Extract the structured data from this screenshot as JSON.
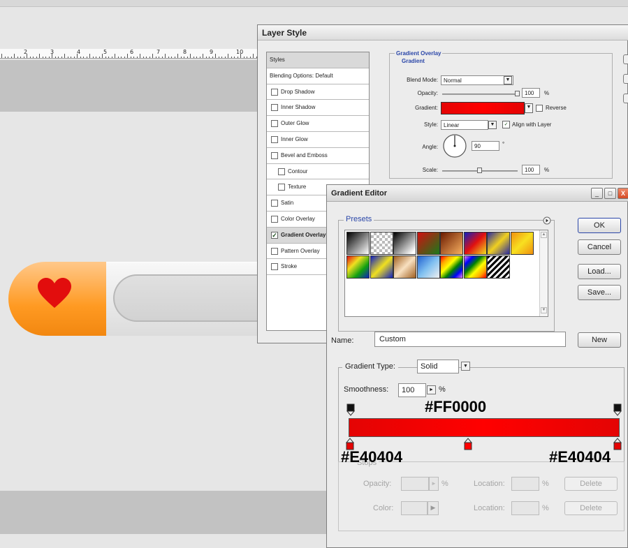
{
  "background": {
    "ruler_numbers": [
      "2",
      "3",
      "4",
      "5",
      "6",
      "7",
      "8",
      "9",
      "10"
    ]
  },
  "layer_style": {
    "title": "Layer Style",
    "styles_list": [
      {
        "label": "Styles",
        "type": "head"
      },
      {
        "label": "Blending Options: Default",
        "type": "head"
      },
      {
        "label": "Drop Shadow",
        "checked": false
      },
      {
        "label": "Inner Shadow",
        "checked": false
      },
      {
        "label": "Outer Glow",
        "checked": false
      },
      {
        "label": "Inner Glow",
        "checked": false
      },
      {
        "label": "Bevel and Emboss",
        "checked": false
      },
      {
        "label": "Contour",
        "checked": false,
        "sub": true
      },
      {
        "label": "Texture",
        "checked": false,
        "sub": true
      },
      {
        "label": "Satin",
        "checked": false
      },
      {
        "label": "Color Overlay",
        "checked": false
      },
      {
        "label": "Gradient Overlay",
        "checked": true,
        "selected": true
      },
      {
        "label": "Pattern Overlay",
        "checked": false
      },
      {
        "label": "Stroke",
        "checked": false
      }
    ],
    "panel": {
      "section_title": "Gradient Overlay",
      "group_title": "Gradient",
      "blend_mode_label": "Blend Mode:",
      "blend_mode_value": "Normal",
      "opacity_label": "Opacity:",
      "opacity_value": "100",
      "opacity_unit": "%",
      "opacity_level": 1.0,
      "gradient_label": "Gradient:",
      "reverse_label": "Reverse",
      "reverse_checked": false,
      "style_label": "Style:",
      "style_value": "Linear",
      "align_label": "Align with Layer",
      "align_checked": true,
      "angle_label": "Angle:",
      "angle_value": "90",
      "angle_unit": "°",
      "scale_label": "Scale:",
      "scale_value": "100",
      "scale_unit": "%",
      "scale_level": 0.5
    }
  },
  "gradient_editor": {
    "title": "Gradient Editor",
    "window_controls": {
      "minimize": "_",
      "maximize": "□",
      "close": "X"
    },
    "presets_label": "Presets",
    "presets_menu_icon": "arrow-circle-icon",
    "buttons": {
      "ok": "OK",
      "cancel": "Cancel",
      "load": "Load...",
      "save": "Save...",
      "new": "New"
    },
    "name_label": "Name:",
    "name_value": "Custom",
    "gradient_type_label": "Gradient Type:",
    "gradient_type_value": "Solid",
    "smoothness_label": "Smoothness:",
    "smoothness_value": "100",
    "smoothness_unit": "%",
    "gradient_colors": {
      "left": "#E40404",
      "mid": "#FF0000",
      "right": "#E40404"
    },
    "annotations": {
      "top": "#FF0000",
      "bottom_left": "#E40404",
      "bottom_right": "#E40404"
    },
    "stops_group_label": "Stops",
    "opacity_label": "Opacity:",
    "opacity_unit": "%",
    "location_label": "Location:",
    "location_unit": "%",
    "color_label": "Color:",
    "delete_label": "Delete"
  },
  "colors": {
    "heart": "#e20d0d",
    "pill_orange": "#ff9a22",
    "link_blue": "#2a46a8"
  }
}
